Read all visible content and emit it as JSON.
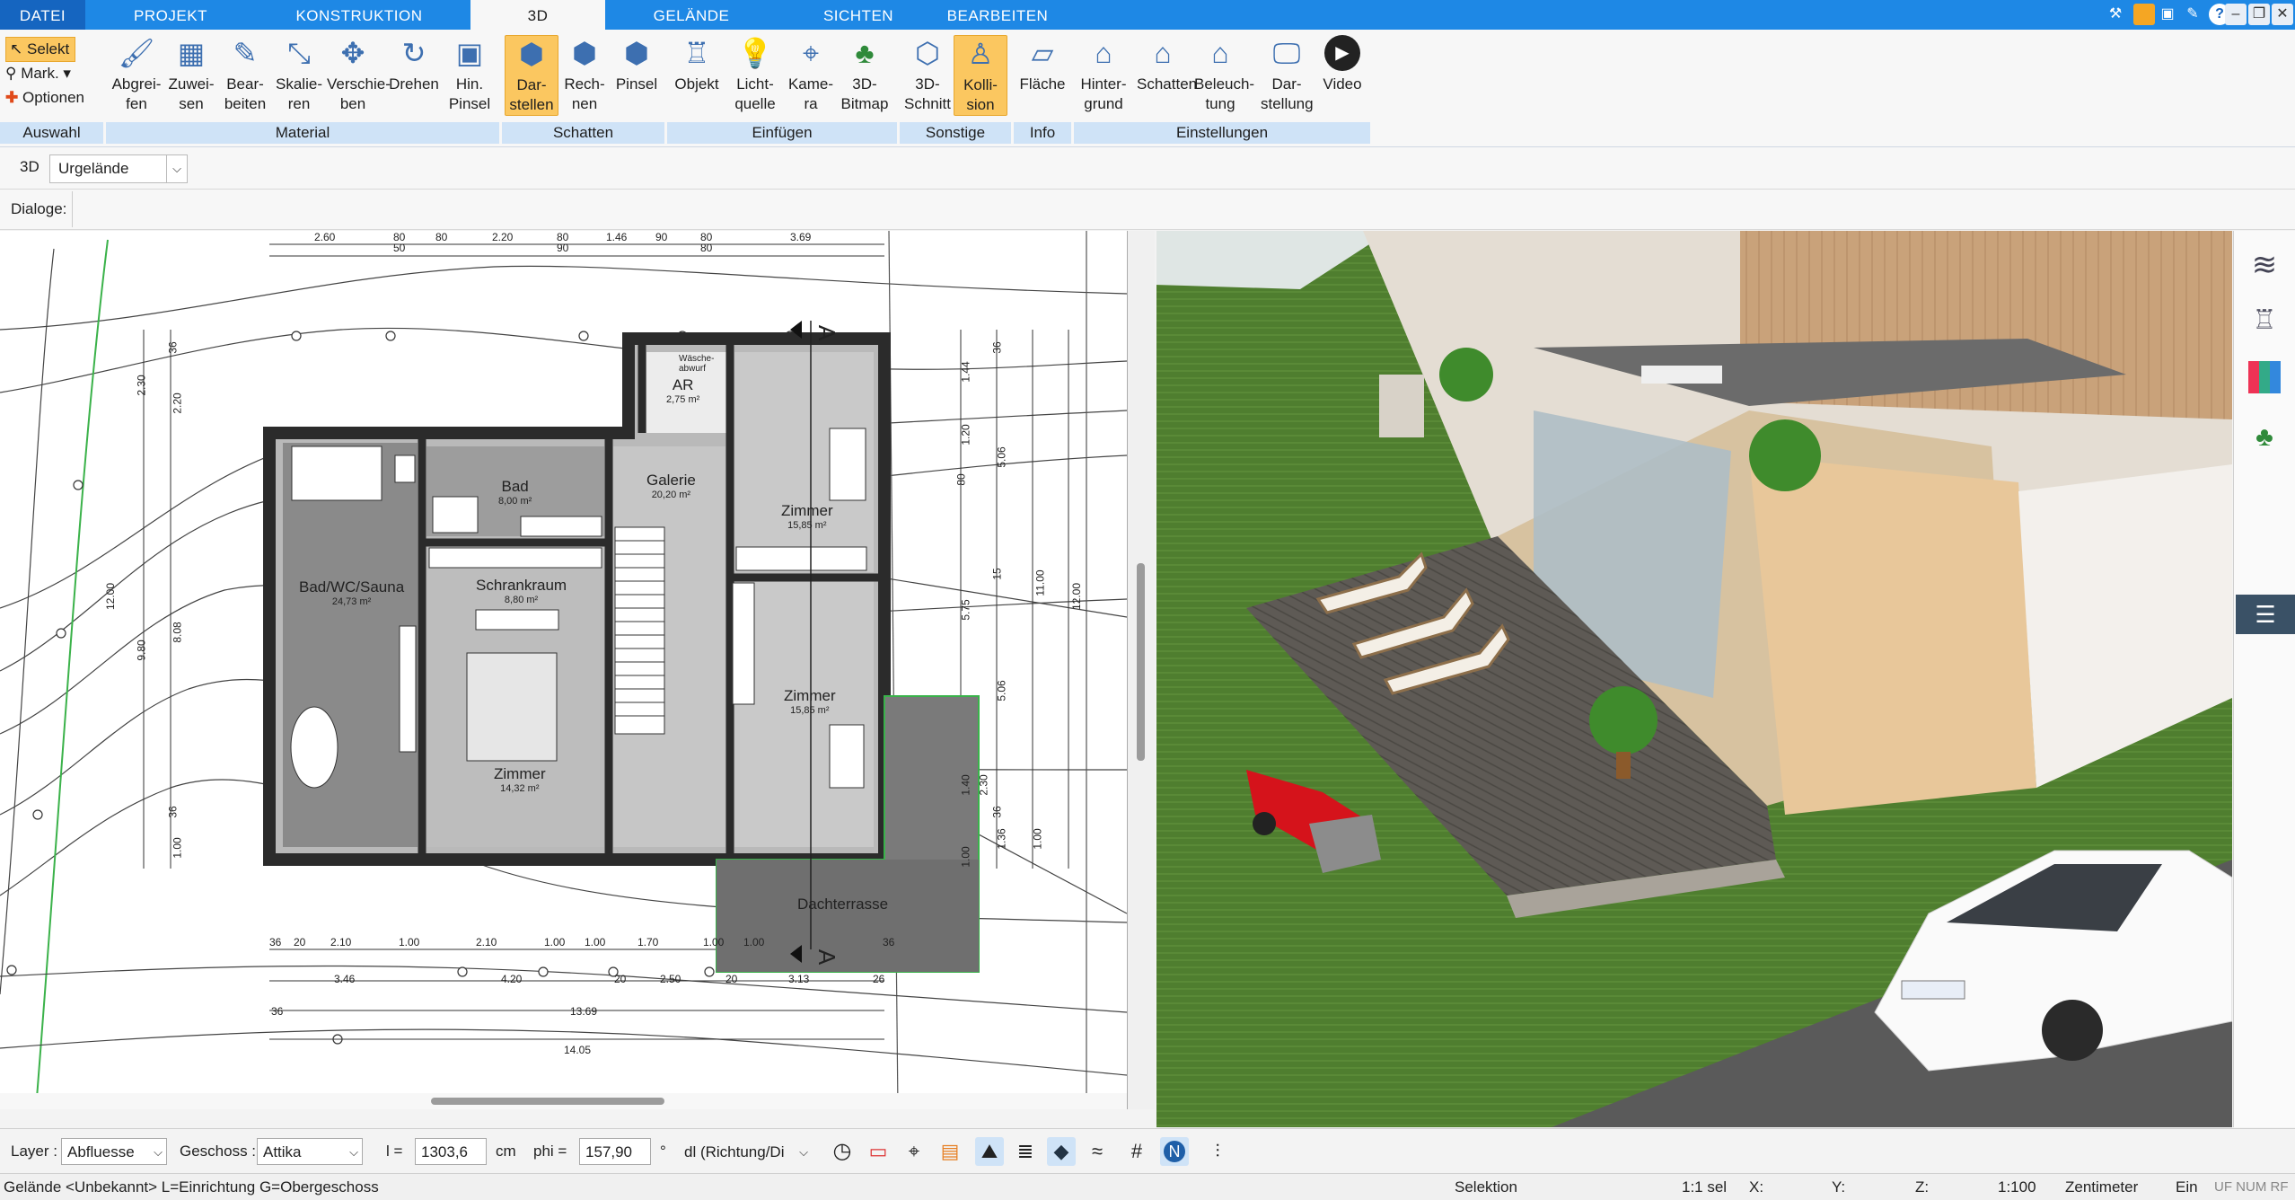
{
  "menu": {
    "tabs": [
      "DATEI",
      "PROJEKT",
      "KONSTRUKTION",
      "3D",
      "GELÄNDE",
      "SICHTEN",
      "BEARBEITEN"
    ],
    "active": "3D"
  },
  "ribbon": {
    "auswahl": {
      "items": [
        "Selekt",
        "Mark.",
        "Optionen"
      ],
      "group": "Auswahl"
    },
    "material": {
      "buttons": [
        [
          "Abgrei-",
          "fen"
        ],
        [
          "Zuwei-",
          "sen"
        ],
        [
          "Bear-",
          "beiten"
        ],
        [
          "Skalie-",
          "ren"
        ],
        [
          "Verschie-",
          "ben"
        ],
        [
          "Drehen",
          ""
        ],
        [
          "Hin.",
          "Pinsel"
        ]
      ],
      "group": "Material"
    },
    "schatten": {
      "buttons": [
        [
          "Dar-",
          "stellen"
        ],
        [
          "Rech-",
          "nen"
        ],
        [
          "Pinsel",
          ""
        ]
      ],
      "group": "Schatten"
    },
    "einfuegen": {
      "buttons": [
        [
          "Objekt",
          ""
        ],
        [
          "Licht-",
          "quelle"
        ],
        [
          "Kame-",
          "ra"
        ],
        [
          "3D-",
          "Bitmap"
        ]
      ],
      "group": "Einfügen"
    },
    "sonstige": {
      "buttons": [
        [
          "3D-",
          "Schnitt"
        ],
        [
          "Kolli-",
          "sion"
        ]
      ],
      "group": "Sonstige"
    },
    "info": {
      "buttons": [
        [
          "Fläche",
          ""
        ]
      ],
      "group": "Info"
    },
    "einstellungen": {
      "buttons": [
        [
          "Hinter-",
          "grund"
        ],
        [
          "Schatten",
          ""
        ],
        [
          "Beleuch-",
          "tung"
        ],
        [
          "Dar-",
          "stellung"
        ],
        [
          "Video",
          ""
        ]
      ],
      "group": "Einstellungen"
    }
  },
  "row1": {
    "mode": "3D",
    "select_value": "Urgelände"
  },
  "row2": {
    "label": "Dialoge:"
  },
  "plan": {
    "rooms": [
      {
        "name": "Bad",
        "area": "8,00 m²"
      },
      {
        "name": "Galerie",
        "area": "20,20 m²"
      },
      {
        "name": "Zimmer",
        "area": "15,85 m²"
      },
      {
        "name": "Bad/WC/Sauna",
        "area": "24,73 m²"
      },
      {
        "name": "Schrankraum",
        "area": "8,80 m²"
      },
      {
        "name": "Zimmer",
        "area": "15,85 m²"
      },
      {
        "name": "Zimmer",
        "area": "14,32 m²"
      },
      {
        "name": "AR",
        "area": "2,75 m²"
      },
      {
        "name": "Dachterrasse",
        "area": ""
      }
    ],
    "wascheabwurf": "Wäsche-abwurf",
    "dims_top": [
      "2.60",
      "80",
      "50",
      "80",
      "2.20",
      "80",
      "90",
      "1.46",
      "90",
      "80",
      "80",
      "3.69"
    ],
    "dims_bottom1": [
      "36",
      "20",
      "2.10",
      "1.00",
      "2.10",
      "1.00",
      "1.00",
      "1.70",
      "1.00",
      "1.00",
      "36"
    ],
    "dims_bottom2": [
      "3.46",
      "4.20",
      "20",
      "2.50",
      "20",
      "3.13",
      "26"
    ],
    "dims_bottom3": [
      "36",
      "13.69"
    ],
    "dims_bottom4": "14.05",
    "dims_left": [
      "36",
      "2.30",
      "2.20",
      "12.00",
      "9.80",
      "8.08",
      "36",
      "1.00"
    ],
    "dims_right": [
      "36",
      "1.44",
      "1.20",
      "5.06",
      "80",
      "15",
      "5.75",
      "5.06",
      "36",
      "1.40",
      "2.30",
      "1.00",
      "1.36",
      "11.00",
      "12.00",
      "1.00"
    ],
    "section_marks": [
      "A",
      "A"
    ]
  },
  "bottom": {
    "layer_label": "Layer :",
    "layer_value": "Abfluesse",
    "geschoss_label": "Geschoss :",
    "geschoss_value": "Attika",
    "l_label": "l =",
    "l_value": "1303,6",
    "l_unit": "cm",
    "phi_label": "phi =",
    "phi_value": "157,90",
    "phi_unit": "°",
    "dl_value": "dl (Richtung/Di"
  },
  "status": {
    "left": "Gelände <Unbekannt> L=Einrichtung G=Obergeschoss",
    "mode": "Selektion",
    "sel": "1:1 sel",
    "x": "X:",
    "y": "Y:",
    "z": "Z:",
    "scale": "1:100",
    "unit": "Zentimeter",
    "ein": "Ein",
    "flags": "UF NUM RF"
  },
  "colors": {
    "accent": "#1e88e5",
    "ribbon_group": "#cfe3f7",
    "highlight": "#fbc760",
    "grass": "#4d7b2e"
  }
}
